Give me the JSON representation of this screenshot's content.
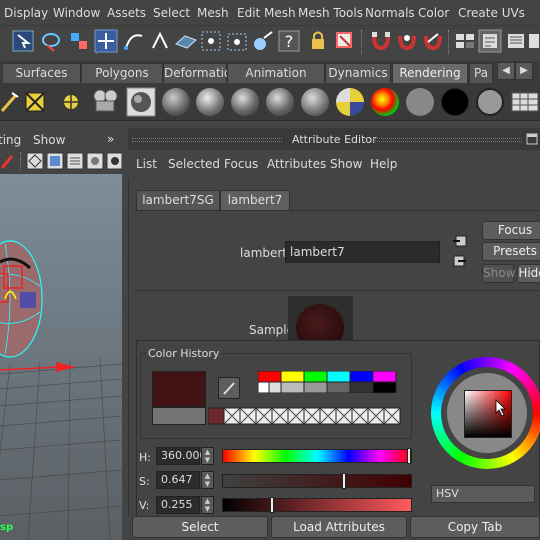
{
  "menubar": {
    "items": [
      "Display",
      "Window",
      "Assets",
      "Select",
      "Mesh",
      "Edit Mesh",
      "Mesh Tools",
      "Normals",
      "Color",
      "Create UVs"
    ]
  },
  "toolbar": {
    "icons": [
      "select-tool-icon",
      "lasso-tool-icon",
      "paint-select-icon",
      "filter-icon",
      "snap-grid-icon",
      "snap-curve-icon",
      "snap-point-icon",
      "snap-plane-icon",
      "snap-surface-icon",
      "snap-live-icon",
      "help-icon",
      "lock-icon",
      "input-ops-icon",
      "magnet-icon",
      "symmetry-icon",
      "history-icon",
      "render-icon",
      "ipr-icon",
      "render-settings-icon"
    ]
  },
  "shelf_tabs": {
    "items": [
      "Surfaces",
      "Polygons",
      "Deformation",
      "Animation",
      "Dynamics",
      "Rendering",
      "Pa"
    ],
    "active": "Rendering"
  },
  "viewport": {
    "menu": [
      "ting",
      "Show"
    ],
    "status_text": "sp"
  },
  "attribute_editor": {
    "title": "Attribute Editor",
    "menu": [
      "List",
      "Selected",
      "Focus",
      "Attributes",
      "Show",
      "Help"
    ],
    "node_tabs": [
      "lambert7SG",
      "lambert7"
    ],
    "active_tab": "lambert7",
    "node_label": "lambert:",
    "node_name": "lambert7",
    "focus_label": "Focus",
    "presets_label": "Presets",
    "show_label": "Show",
    "hide_label": "Hide",
    "sample_label": "Sample"
  },
  "color_chooser": {
    "history_label": "Color History",
    "h_label": "H:",
    "h_value": "360.000",
    "s_label": "S:",
    "s_value": "0.647",
    "v_label": "V:",
    "v_value": "0.255",
    "h_fraction": 1.0,
    "s_fraction": 0.647,
    "v_fraction": 0.255,
    "mode": "HSV",
    "current_color": "#411314",
    "previous_color": "#737373"
  },
  "bottom": {
    "select_label": "Select",
    "load_label": "Load Attributes",
    "copy_label": "Copy Tab"
  }
}
